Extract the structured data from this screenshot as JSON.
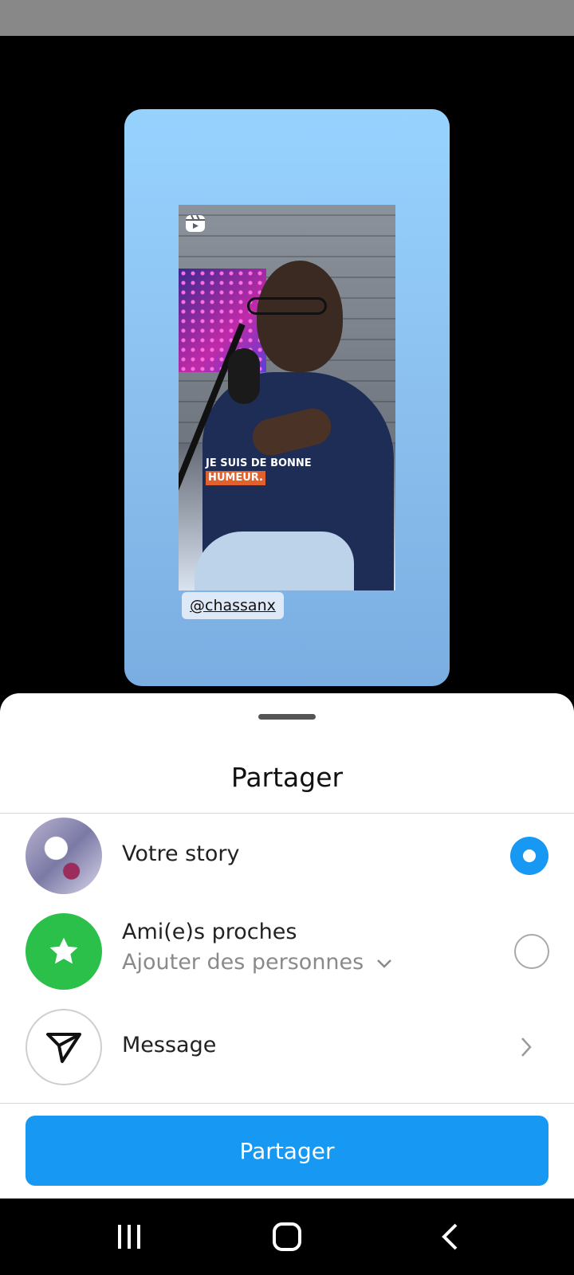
{
  "preview": {
    "caption_line1": "JE SUIS DE BONNE",
    "caption_line2": "HUMEUR.",
    "username": "@chassanx",
    "reel_icon": "reels-icon"
  },
  "sheet": {
    "title": "Partager",
    "options": [
      {
        "label": "Votre story",
        "selected": true,
        "icon": "story-avatar"
      },
      {
        "label": "Ami(e)s proches",
        "sublabel": "Ajouter des personnes",
        "selected": false,
        "icon": "star-icon"
      },
      {
        "label": "Message",
        "icon": "send-icon"
      }
    ],
    "share_button": "Partager"
  },
  "colors": {
    "accent": "#1798f2",
    "close_friends": "#2bc04a",
    "card_gradient_top": "#97d2ff"
  },
  "nav": {
    "recents": "recent-apps-icon",
    "home": "home-icon",
    "back": "back-icon"
  }
}
